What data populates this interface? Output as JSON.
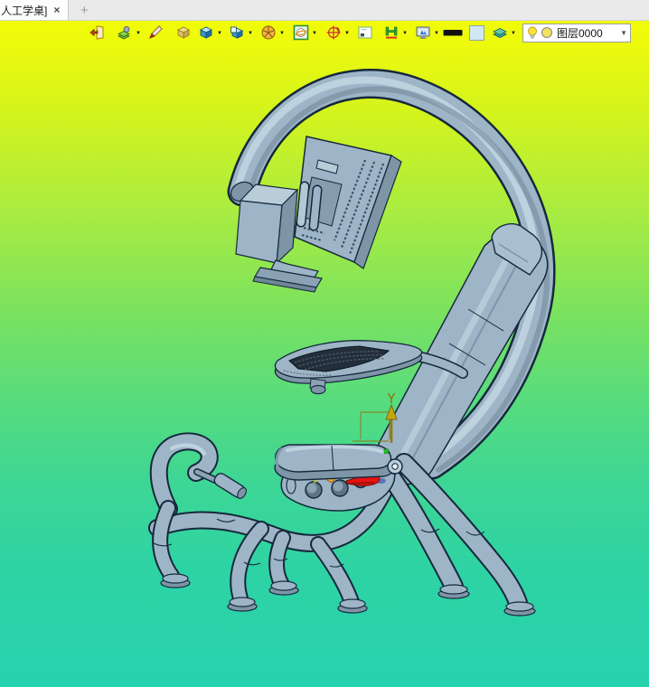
{
  "tab_bar": {
    "active_tab": {
      "label": "人工学桌]",
      "close_glyph": "×"
    },
    "new_tab_glyph": "+"
  },
  "toolbar": {
    "dropdown_glyph": "▼",
    "icons": [
      {
        "name": "exit-door-icon",
        "dropdown": false
      },
      {
        "name": "render-sheets-icon",
        "dropdown": true
      },
      {
        "name": "sketch-pen-icon",
        "dropdown": false
      },
      {
        "name": "solid-box-icon",
        "dropdown": false
      },
      {
        "name": "view-cube-icon",
        "dropdown": true
      },
      {
        "name": "cube-face-icon",
        "dropdown": true
      },
      {
        "name": "segment-wheel-icon",
        "dropdown": true
      },
      {
        "name": "sphere-frame-icon",
        "dropdown": true
      },
      {
        "name": "rotate-crosshair-icon",
        "dropdown": true
      },
      {
        "name": "viewport-icon",
        "dropdown": false
      },
      {
        "name": "dimension-icon",
        "dropdown": true
      },
      {
        "name": "display-monitor-icon",
        "dropdown": true
      },
      {
        "name": "line-width-icon",
        "dropdown": false
      },
      {
        "name": "color-swatch-icon",
        "dropdown": false
      },
      {
        "name": "layers-icon",
        "dropdown": true
      }
    ]
  },
  "layer_combo": {
    "label": "图层0000",
    "dropdown_glyph": "▼",
    "bulb_icon": "lightbulb-icon",
    "color_swatch": "#f2e060"
  },
  "canvas": {
    "axis_y_label": "Y",
    "model": "ergonomic-scorpion-workstation-chair"
  },
  "colors": {
    "bg_top": "#f4fd04",
    "bg_bottom": "#26d2ae",
    "model_fill": "#9db5c6",
    "model_shade": "#7e95a8",
    "model_light": "#c3d6e2",
    "outline": "#16283c",
    "lever_red": "#e81212",
    "handle_orange": "#f2a51e",
    "axis_olive": "#8f7d14"
  }
}
